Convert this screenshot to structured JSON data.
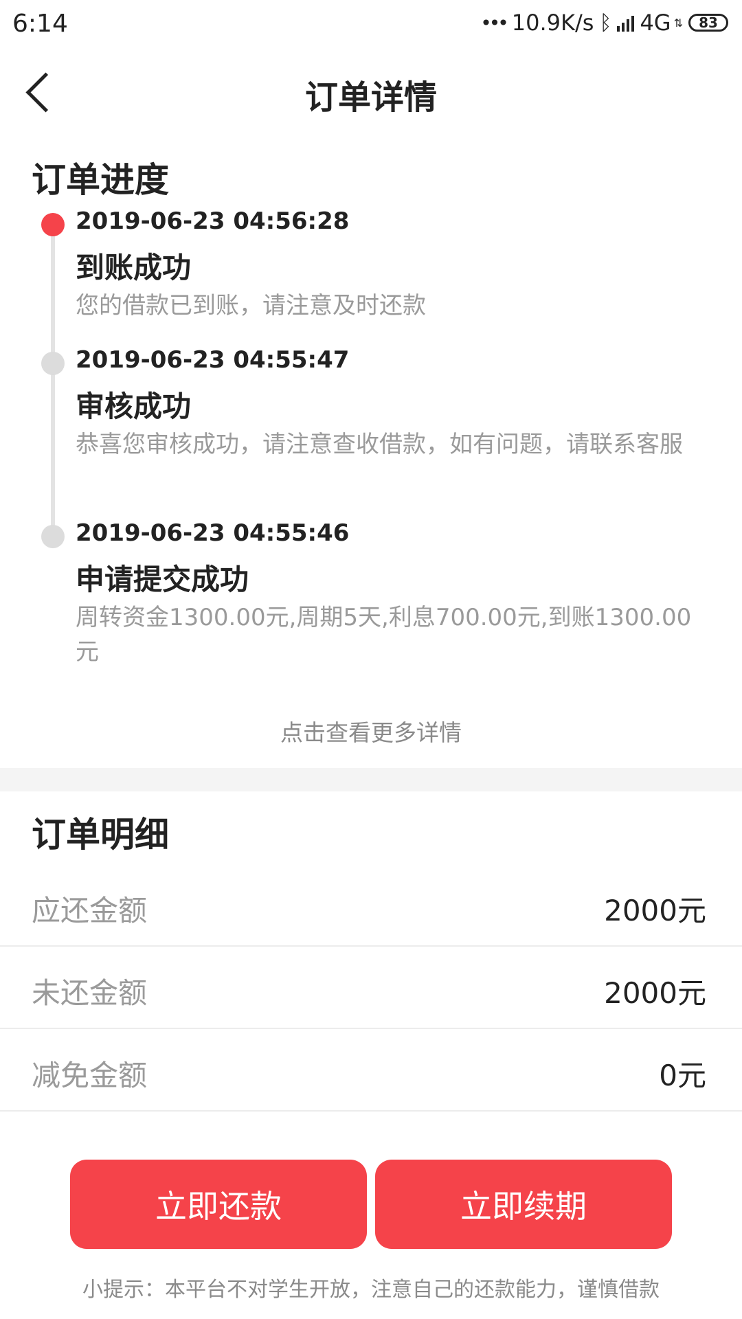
{
  "status_bar": {
    "time": "6:14",
    "network_speed": "10.9K/s",
    "network_type": "4G",
    "battery": "83",
    "icons": [
      "dots-icon",
      "bluetooth-icon",
      "signal-icon",
      "battery-icon"
    ]
  },
  "nav": {
    "title": "订单详情",
    "back_icon": "chevron-left-icon"
  },
  "progress": {
    "title": "订单进度",
    "items": [
      {
        "time": "2019-06-23 04:56:28",
        "status": "到账成功",
        "desc": "您的借款已到账，请注意及时还款",
        "active": true
      },
      {
        "time": "2019-06-23 04:55:47",
        "status": "审核成功",
        "desc": "恭喜您审核成功，请注意查收借款，如有问题，请联系客服",
        "active": false
      },
      {
        "time": "2019-06-23 04:55:46",
        "status": "申请提交成功",
        "desc": "周转资金1300.00元,周期5天,利息700.00元,到账1300.00元",
        "active": false
      }
    ],
    "more_link": "点击查看更多详情"
  },
  "details": {
    "title": "订单明细",
    "rows": [
      {
        "label": "应还金额",
        "value": "2000元"
      },
      {
        "label": "未还金额",
        "value": "2000元"
      },
      {
        "label": "减免金额",
        "value": "0元"
      }
    ]
  },
  "actions": {
    "repay_label": "立即还款",
    "renew_label": "立即续期"
  },
  "tip": "小提示：本平台不对学生开放，注意自己的还款能力，谨慎借款",
  "colors": {
    "accent": "#f5434a",
    "inactive_dot": "#dcdcdc",
    "muted_text": "#9a9a9a",
    "divider": "#ececec"
  }
}
